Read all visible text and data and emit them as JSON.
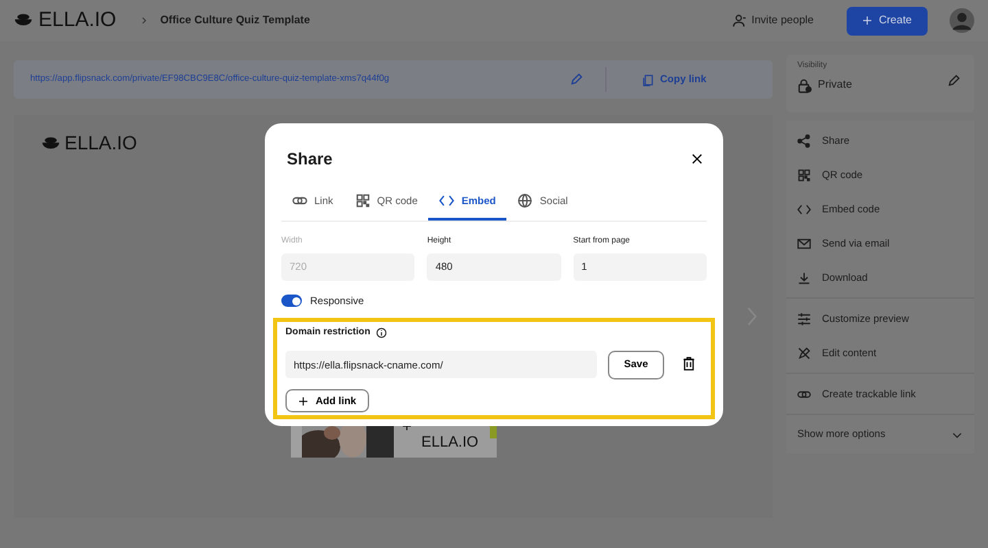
{
  "header": {
    "logo": "ELLA.IO",
    "title": "Office Culture Quiz Template",
    "invite": "Invite people",
    "create": "Create"
  },
  "link_bar": {
    "url": "https://app.flipsnack.com/private/EF98CBC9E8C/office-culture-quiz-template-xms7q44f0g",
    "copy": "Copy link"
  },
  "visibility": {
    "label": "Visibility",
    "value": "Private"
  },
  "action_groups": [
    [
      {
        "label": "Share"
      },
      {
        "label": "QR code"
      },
      {
        "label": "Embed code"
      },
      {
        "label": "Send via email"
      },
      {
        "label": "Download"
      }
    ],
    [
      {
        "label": "Customize preview"
      },
      {
        "label": "Edit content"
      }
    ],
    [
      {
        "label": "Create trackable link"
      }
    ]
  ],
  "show_more": "Show more options",
  "preview": {
    "logo": "ELLA.IO",
    "thumbnail_plus": "+",
    "thumbnail_logo": "ELLA.IO"
  },
  "modal": {
    "title": "Share",
    "tabs": [
      {
        "label": "Link",
        "selected": false
      },
      {
        "label": "QR code",
        "selected": false
      },
      {
        "label": "Embed",
        "selected": true
      },
      {
        "label": "Social",
        "selected": false
      }
    ],
    "fields": [
      {
        "label": "Width",
        "value": "720",
        "disabled": true
      },
      {
        "label": "Height",
        "value": "480",
        "disabled": false
      },
      {
        "label": "Start from page",
        "value": "1",
        "disabled": false
      }
    ],
    "responsive": {
      "label": "Responsive",
      "on": true
    },
    "domain": {
      "title": "Domain restriction",
      "url": "https://ella.flipsnack-cname.com/",
      "save": "Save",
      "add": "Add link"
    }
  }
}
